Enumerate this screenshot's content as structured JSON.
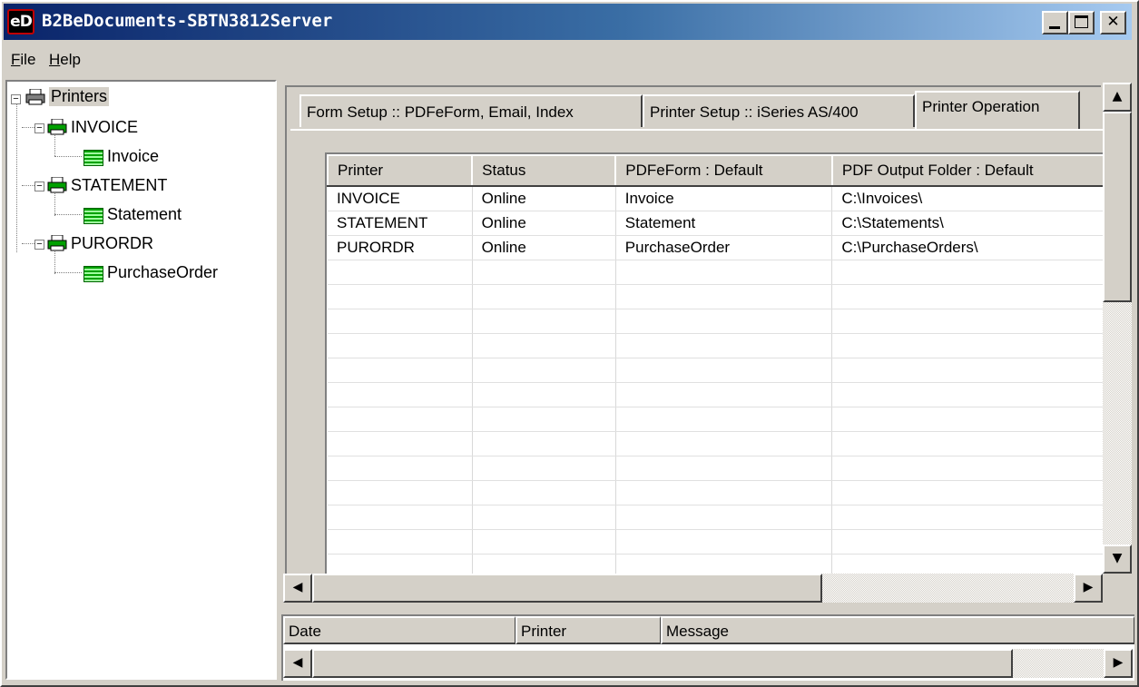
{
  "window": {
    "app_icon_text": "eD",
    "title": "B2BeDocuments-SBTN3812Server"
  },
  "menu": {
    "file_first": "F",
    "file_rest": "ile",
    "help_first": "H",
    "help_rest": "elp"
  },
  "tree": {
    "root": "Printers",
    "printers": [
      {
        "name": "INVOICE",
        "form": "Invoice"
      },
      {
        "name": "STATEMENT",
        "form": "Statement"
      },
      {
        "name": "PURORDR",
        "form": "PurchaseOrder"
      }
    ]
  },
  "tabs": [
    {
      "label": "Form Setup :: PDFeForm, Email, Index"
    },
    {
      "label": "Printer Setup :: iSeries AS/400"
    },
    {
      "label": "Printer Operation"
    }
  ],
  "grid": {
    "columns": [
      "Printer",
      "Status",
      "PDFeForm : Default",
      "PDF Output Folder : Default"
    ],
    "rows": [
      [
        "INVOICE",
        "Online",
        "Invoice",
        "C:\\Invoices\\"
      ],
      [
        "STATEMENT",
        "Online",
        "Statement",
        "C:\\Statements\\"
      ],
      [
        "PURORDR",
        "Online",
        "PurchaseOrder",
        "C:\\PurchaseOrders\\"
      ]
    ]
  },
  "log": {
    "columns": [
      "Date",
      "Printer",
      "Message"
    ]
  }
}
